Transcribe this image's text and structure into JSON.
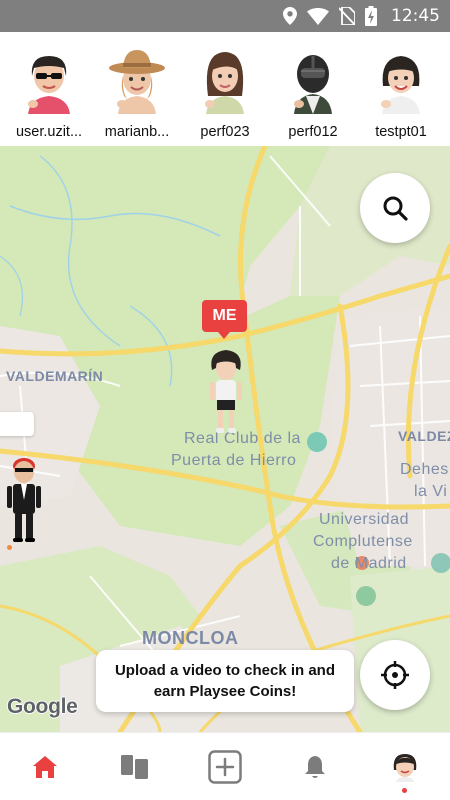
{
  "status_bar": {
    "time": "12:45",
    "icons": [
      "location-icon",
      "wifi-icon",
      "no-sim-icon",
      "battery-charging-icon"
    ]
  },
  "friends": [
    {
      "name": "user.uzit...",
      "avatar": "avatar-sunglasses"
    },
    {
      "name": "marianb...",
      "avatar": "avatar-hat"
    },
    {
      "name": "perf023",
      "avatar": "avatar-long-hair"
    },
    {
      "name": "perf012",
      "avatar": "avatar-helmet"
    },
    {
      "name": "testpt01",
      "avatar": "avatar-bob-hair"
    }
  ],
  "map": {
    "labels": {
      "valdemarin": "VALDEMARÍN",
      "valdez": "VALDEZ",
      "club_line1": "Real Club de la",
      "club_line2": "Puerta de Hierro",
      "uni_line1": "Universidad",
      "uni_line2": "Complutense",
      "uni_line3": "de Madrid",
      "dehes_line1": "Dehes",
      "dehes_line2": "la Vi",
      "moncloa": "MONCLOA"
    },
    "me_marker": "ME",
    "toast": "Upload a video to check in and earn Playsee Coins!",
    "attribution": "Google",
    "search_button_icon": "search-icon",
    "locate_button_icon": "crosshair-icon"
  },
  "tabs": [
    {
      "name": "home",
      "icon": "home-icon",
      "active": true
    },
    {
      "name": "feed",
      "icon": "cards-icon",
      "active": false
    },
    {
      "name": "create",
      "icon": "plus-box-icon",
      "active": false
    },
    {
      "name": "notifications",
      "icon": "bell-icon",
      "active": false
    },
    {
      "name": "profile",
      "icon": "avatar-icon",
      "active": false,
      "badge": true
    }
  ],
  "colors": {
    "accent": "#e8413f",
    "map_park": "#d3e9b5",
    "map_road": "#f6d86b"
  }
}
